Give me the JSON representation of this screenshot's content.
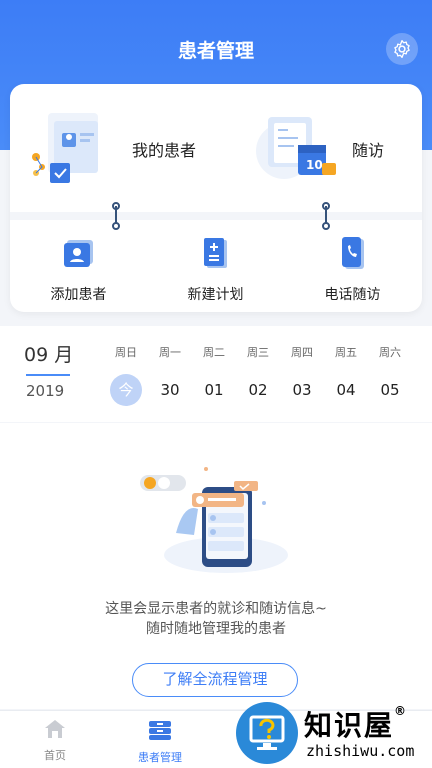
{
  "header": {
    "title": "患者管理",
    "settings_icon": "gear-icon"
  },
  "quick_actions": {
    "primary": [
      {
        "label": "我的患者",
        "icon": "patients-illustration"
      },
      {
        "label": "随访",
        "icon": "calendar-illustration"
      }
    ],
    "secondary": [
      {
        "label": "添加患者",
        "icon": "id-card-icon"
      },
      {
        "label": "新建计划",
        "icon": "document-plus-icon"
      },
      {
        "label": "电话随访",
        "icon": "phone-icon"
      }
    ]
  },
  "calendar": {
    "month": "09 月",
    "year": "2019",
    "days": [
      {
        "weekday": "周日",
        "date": "今",
        "today": true
      },
      {
        "weekday": "周一",
        "date": "30"
      },
      {
        "weekday": "周二",
        "date": "01"
      },
      {
        "weekday": "周三",
        "date": "02"
      },
      {
        "weekday": "周四",
        "date": "03"
      },
      {
        "weekday": "周五",
        "date": "04"
      },
      {
        "weekday": "周六",
        "date": "05"
      }
    ]
  },
  "empty_state": {
    "line1": "这里会显示患者的就诊和随访信息~",
    "line2": "随时随地管理我的患者",
    "button": "了解全流程管理"
  },
  "tabbar": [
    {
      "label": "首页",
      "icon": "home-icon"
    },
    {
      "label": "患者管理",
      "icon": "patient-box-icon",
      "active": true
    }
  ],
  "watermark": {
    "text": "知识屋",
    "reg": "®",
    "sub": "zhishiwu.com"
  },
  "colors": {
    "primary": "#3d7df6",
    "today_bg": "#bfd3f7"
  }
}
